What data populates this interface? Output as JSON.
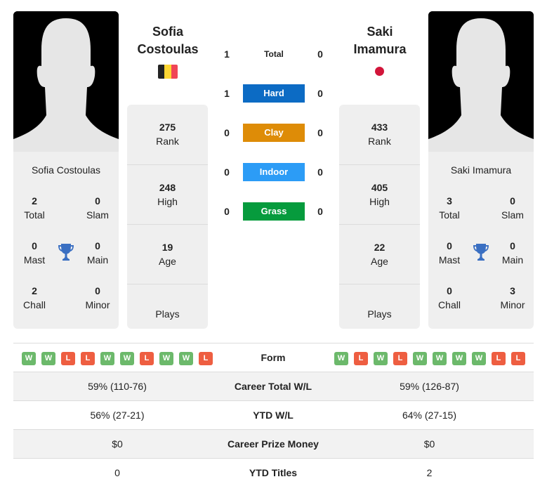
{
  "colors": {
    "win": "#6cb96b",
    "loss": "#ee5e41",
    "hard": "#0c6bc4",
    "clay": "#de8c07",
    "indoor": "#2c9cf6",
    "grass": "#069b3d",
    "trophy": "#3a6fc2",
    "flag_be": [
      "#232323",
      "#fdd633",
      "#f04556"
    ],
    "flag_jp": "#d2153a"
  },
  "player_left": {
    "name_line1": "Sofia",
    "name_line2": "Costoulas",
    "full_name": "Sofia Costoulas",
    "country_flag": "belgium-flag",
    "titles": {
      "total": {
        "value": "2",
        "label": "Total"
      },
      "slam": {
        "value": "0",
        "label": "Slam"
      },
      "mast": {
        "value": "0",
        "label": "Mast"
      },
      "main": {
        "value": "0",
        "label": "Main"
      },
      "chall": {
        "value": "2",
        "label": "Chall"
      },
      "minor": {
        "value": "0",
        "label": "Minor"
      }
    },
    "stats": {
      "rank": {
        "value": "275",
        "label": "Rank"
      },
      "high": {
        "value": "248",
        "label": "High"
      },
      "age": {
        "value": "19",
        "label": "Age"
      },
      "plays": {
        "value": "",
        "label": "Plays"
      }
    },
    "form": [
      "W",
      "W",
      "L",
      "L",
      "W",
      "W",
      "L",
      "W",
      "W",
      "L"
    ]
  },
  "player_right": {
    "name_line1": "Saki",
    "name_line2": "Imamura",
    "full_name": "Saki Imamura",
    "country_flag": "japan-flag",
    "titles": {
      "total": {
        "value": "3",
        "label": "Total"
      },
      "slam": {
        "value": "0",
        "label": "Slam"
      },
      "mast": {
        "value": "0",
        "label": "Mast"
      },
      "main": {
        "value": "0",
        "label": "Main"
      },
      "chall": {
        "value": "0",
        "label": "Chall"
      },
      "minor": {
        "value": "3",
        "label": "Minor"
      }
    },
    "stats": {
      "rank": {
        "value": "433",
        "label": "Rank"
      },
      "high": {
        "value": "405",
        "label": "High"
      },
      "age": {
        "value": "22",
        "label": "Age"
      },
      "plays": {
        "value": "",
        "label": "Plays"
      }
    },
    "form": [
      "W",
      "L",
      "W",
      "L",
      "W",
      "W",
      "W",
      "W",
      "L",
      "L"
    ]
  },
  "h2h": [
    {
      "surface": "Total",
      "left": "1",
      "right": "0"
    },
    {
      "surface": "Hard",
      "left": "1",
      "right": "0"
    },
    {
      "surface": "Clay",
      "left": "0",
      "right": "0"
    },
    {
      "surface": "Indoor",
      "left": "0",
      "right": "0"
    },
    {
      "surface": "Grass",
      "left": "0",
      "right": "0"
    }
  ],
  "comparison": {
    "form_label": "Form",
    "rows": [
      {
        "label": "Career Total W/L",
        "left": "59% (110-76)",
        "right": "59% (126-87)"
      },
      {
        "label": "YTD W/L",
        "left": "56% (27-21)",
        "right": "64% (27-15)"
      },
      {
        "label": "Career Prize Money",
        "left": "$0",
        "right": "$0"
      },
      {
        "label": "YTD Titles",
        "left": "0",
        "right": "2"
      }
    ]
  }
}
